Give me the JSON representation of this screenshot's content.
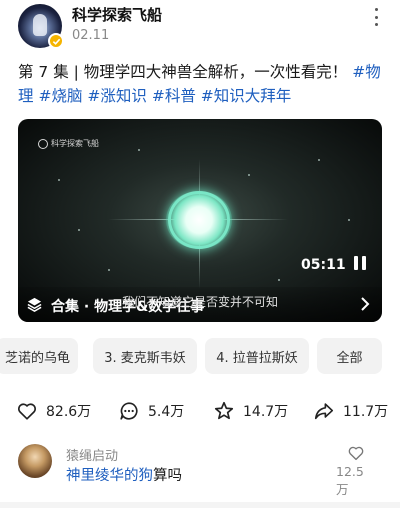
{
  "header": {
    "author": "科学探索飞船",
    "date": "02.11"
  },
  "post": {
    "text": "第 7 集 | 物理学四大神兽全解析，一次性看完！ ",
    "tags": [
      "#物理",
      "#烧脑",
      "#涨知识",
      "#科普",
      "#知识大拜年"
    ]
  },
  "video": {
    "watermark": "科学探索飞船",
    "duration": "05:11",
    "subtitle": "我们不知道它是否变并不可知",
    "collection_label": "合集 · 物理学&数学往事"
  },
  "episodes": [
    {
      "label": "芝诺的乌龟"
    },
    {
      "label": "3. 麦克斯韦妖"
    },
    {
      "label": "4. 拉普拉斯妖"
    },
    {
      "label": "全部"
    }
  ],
  "actions": {
    "likes": "82.6万",
    "comments": "5.4万",
    "favorites": "14.7万",
    "shares": "11.7万"
  },
  "comment": {
    "user": "猿绳启动",
    "text_link": "神里绫华的狗",
    "text_rest": "算吗",
    "like_count": "12.5万"
  },
  "colors": {
    "link": "#1f5fbf",
    "verified_badge": "#f5b400",
    "glow": "#79e6c6"
  },
  "icons": [
    "more-icon",
    "verified-icon",
    "layers-icon",
    "chevron-right-icon",
    "pause-icon",
    "heart-icon",
    "comment-icon",
    "star-icon",
    "share-icon"
  ]
}
